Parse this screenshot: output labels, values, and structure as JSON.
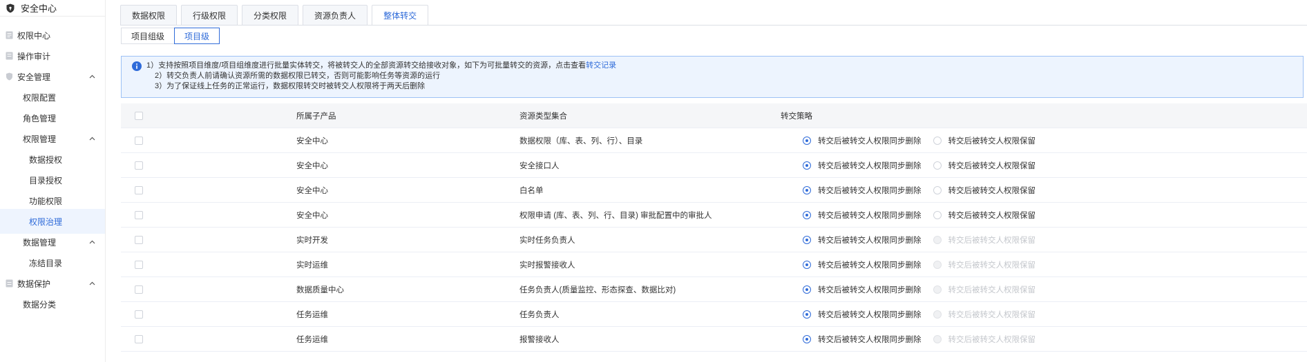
{
  "sidebar": {
    "header": "安全中心",
    "items": [
      {
        "label": "权限中心",
        "icon": "permission-doc-icon",
        "level": 0,
        "expanded": null,
        "active": false
      },
      {
        "label": "操作审计",
        "icon": "audit-doc-icon",
        "level": 0,
        "expanded": null,
        "active": false
      },
      {
        "label": "安全管理",
        "icon": "shield-icon",
        "level": 0,
        "expanded": true,
        "active": false
      },
      {
        "label": "权限配置",
        "icon": "",
        "level": 1,
        "expanded": null,
        "active": false
      },
      {
        "label": "角色管理",
        "icon": "",
        "level": 1,
        "expanded": null,
        "active": false
      },
      {
        "label": "权限管理",
        "icon": "",
        "level": 1,
        "expanded": true,
        "active": false
      },
      {
        "label": "数据授权",
        "icon": "",
        "level": 2,
        "expanded": null,
        "active": false
      },
      {
        "label": "目录授权",
        "icon": "",
        "level": 2,
        "expanded": null,
        "active": false
      },
      {
        "label": "功能权限",
        "icon": "",
        "level": 2,
        "expanded": null,
        "active": false
      },
      {
        "label": "权限治理",
        "icon": "",
        "level": 2,
        "expanded": null,
        "active": true
      },
      {
        "label": "数据管理",
        "icon": "",
        "level": 1,
        "expanded": true,
        "active": false
      },
      {
        "label": "冻结目录",
        "icon": "",
        "level": 2,
        "expanded": null,
        "active": false
      },
      {
        "label": "数据保护",
        "icon": "data-protect-icon",
        "level": 0,
        "expanded": true,
        "active": false
      },
      {
        "label": "数据分类",
        "icon": "",
        "level": 1,
        "expanded": null,
        "active": false
      }
    ]
  },
  "tabs": [
    {
      "label": "数据权限",
      "active": false
    },
    {
      "label": "行级权限",
      "active": false
    },
    {
      "label": "分类权限",
      "active": false
    },
    {
      "label": "资源负责人",
      "active": false
    },
    {
      "label": "整体转交",
      "active": true
    }
  ],
  "segments": [
    {
      "label": "项目组级",
      "active": false
    },
    {
      "label": "项目级",
      "active": true
    }
  ],
  "alert": {
    "line1_prefix": "1）支持按照项目维度/项目组维度进行批量实体转交，将被转交人的全部资源转交给接收对象，如下为可批量转交的资源，点击查看",
    "line1_link": "转交记录",
    "line2": "2）转交负责人前请确认资源所需的数据权限已转交，否则可能影响任务等资源的运行",
    "line3": "3）为了保证线上任务的正常运行，数据权限转交时被转交人权限将于两天后删除"
  },
  "table": {
    "headers": {
      "product": "所属子产品",
      "resource": "资源类型集合",
      "policy": "转交策略"
    },
    "option_delete": "转交后被转交人权限同步删除",
    "option_keep": "转交后被转交人权限保留",
    "rows": [
      {
        "product": "安全中心",
        "resource": "数据权限（库、表、列、行）、目录",
        "keep_disabled": false
      },
      {
        "product": "安全中心",
        "resource": "安全接口人",
        "keep_disabled": false
      },
      {
        "product": "安全中心",
        "resource": "白名单",
        "keep_disabled": false
      },
      {
        "product": "安全中心",
        "resource": "权限申请 (库、表、列、行、目录) 审批配置中的审批人",
        "keep_disabled": false
      },
      {
        "product": "实时开发",
        "resource": "实时任务负责人",
        "keep_disabled": true
      },
      {
        "product": "实时运维",
        "resource": "实时报警接收人",
        "keep_disabled": true
      },
      {
        "product": "数据质量中心",
        "resource": "任务负责人(质量监控、形态探查、数据比对)",
        "keep_disabled": true
      },
      {
        "product": "任务运维",
        "resource": "任务负责人",
        "keep_disabled": true
      },
      {
        "product": "任务运维",
        "resource": "报警接收人",
        "keep_disabled": true
      }
    ]
  },
  "colors": {
    "accent": "#2f6bd9",
    "alert_bg": "#edf4fe",
    "header_bg": "#f5f6f8"
  }
}
